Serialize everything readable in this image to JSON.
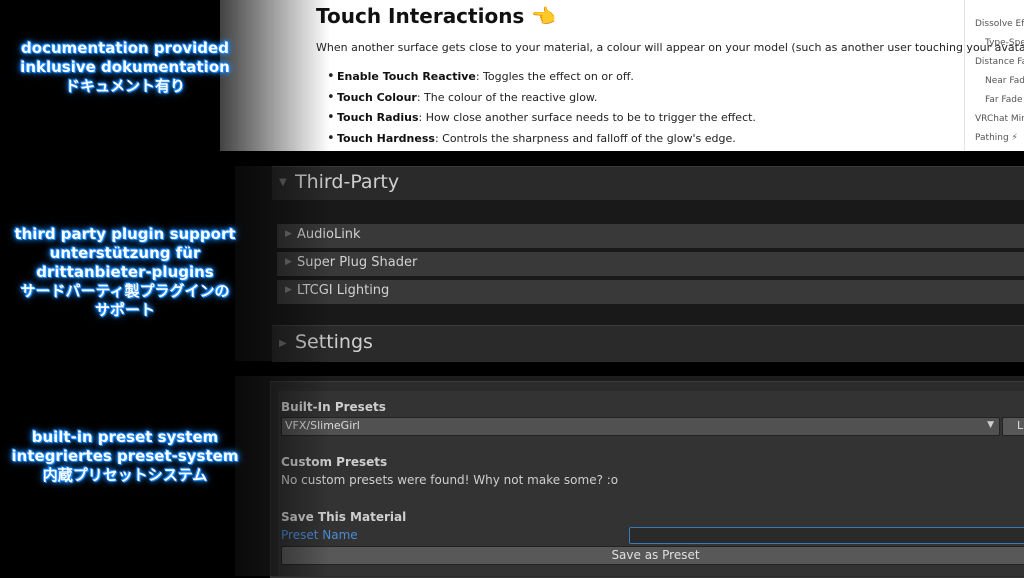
{
  "captions": {
    "docs": [
      "documentation provided",
      "inklusive dokumentation",
      "ドキュメント有り"
    ],
    "thirdparty": [
      "third party plugin support",
      "unterstützung für",
      "drittanbieter-plugins",
      "サードパーティ製プラグインの",
      "サポート"
    ],
    "presets": [
      "built-in preset system",
      "integriertes preset-system",
      "内蔵プリセットシステム"
    ]
  },
  "docs": {
    "title": "Touch Interactions",
    "title_emoji": "👈",
    "intro": "When another surface gets close to your material, a colour will appear on your model (such as another user touching your avatar).",
    "items": [
      {
        "term": "Enable Touch Reactive",
        "desc": ": Toggles the effect on or off."
      },
      {
        "term": "Touch Colour",
        "desc": ": The colour of the reactive glow."
      },
      {
        "term": "Touch Radius",
        "desc": ": How close another surface needs to be to trigger the effect."
      },
      {
        "term": "Touch Hardness",
        "desc": ": Controls the sharpness and falloff of the glow's edge."
      }
    ],
    "toc": [
      "Dissolve Effec",
      "Type-Spec",
      "Distance Fadi",
      "Near Fade",
      "Far Fade",
      "VRChat Mirro",
      "Pathing ⚡"
    ]
  },
  "thirdparty": {
    "header": "Third-Party",
    "plugins": [
      "AudioLink",
      "Super Plug Shader",
      "LTCGI Lighting"
    ]
  },
  "settings": {
    "header": "Settings"
  },
  "presets": {
    "builtin_label": "Built-In Presets",
    "builtin_value": "VFX/SlimeGirl",
    "load_button": "L",
    "custom_label": "Custom Presets",
    "custom_empty": "No custom presets were found! Why not make some? :o",
    "save_label": "Save This Material",
    "preset_name_label": "Preset Name",
    "preset_name_value": "",
    "save_button": "Save as Preset"
  }
}
